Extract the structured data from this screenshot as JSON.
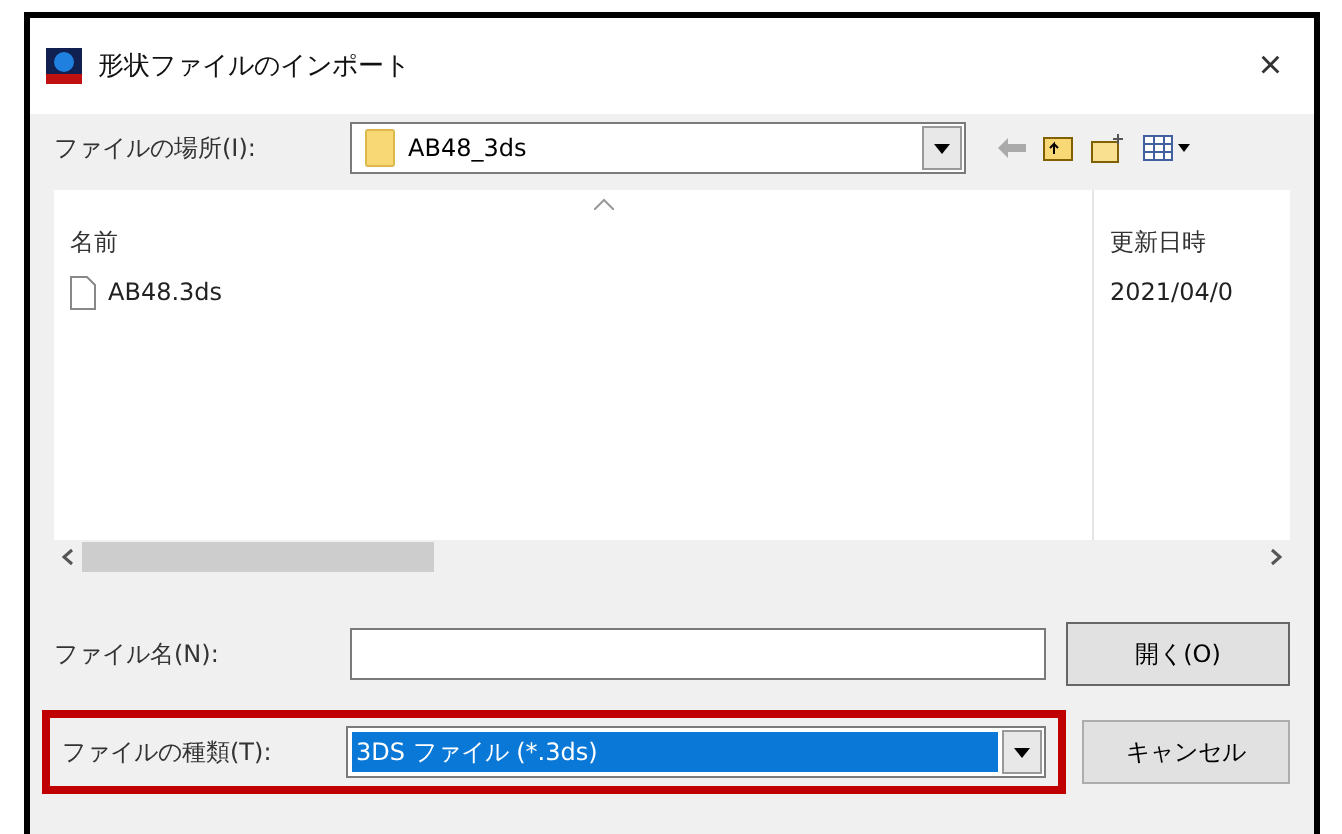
{
  "window": {
    "title": "形状ファイルのインポート",
    "close": "×"
  },
  "location": {
    "label": "ファイルの場所(I):",
    "value": "AB48_3ds"
  },
  "file_list": {
    "columns": [
      "名前",
      "更新日時"
    ],
    "rows": [
      {
        "name": "AB48.3ds",
        "date": "2021/04/0"
      }
    ]
  },
  "file_name": {
    "label": "ファイル名(N):"
  },
  "file_type": {
    "label": "ファイルの種類(T):",
    "value": "3DS ファイル (*.3ds)",
    "selected": true,
    "highlighted": true
  },
  "buttons": [
    {
      "label": "開く(O)",
      "kind": "default"
    },
    {
      "label": "キャンセル",
      "kind": "normal"
    }
  ]
}
